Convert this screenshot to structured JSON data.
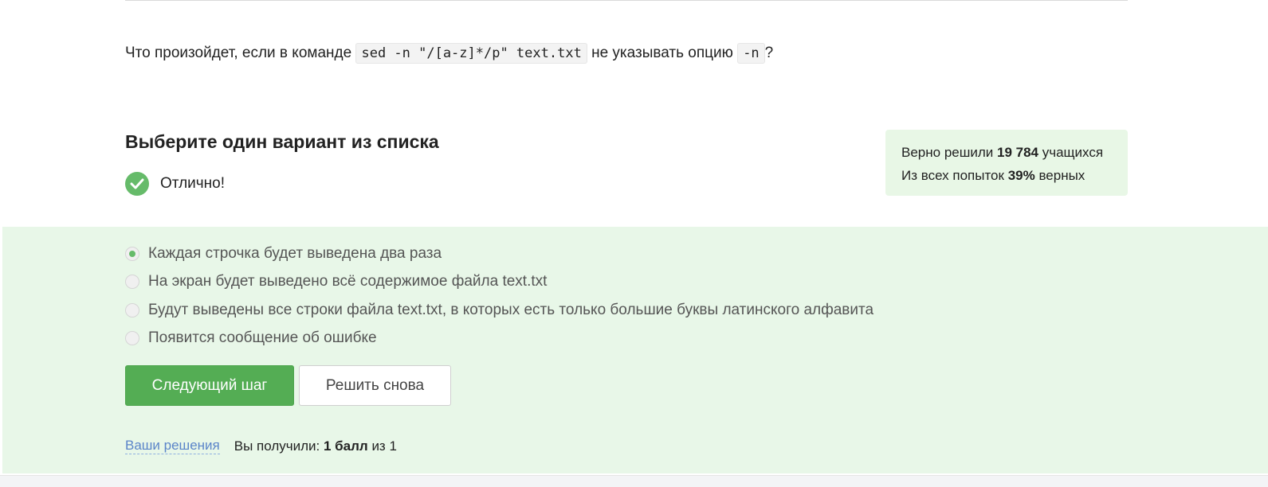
{
  "question": {
    "prefix": "Что произойдет, если в команде",
    "command": "sed -n \"/[a-z]*/p\" text.txt",
    "middle": "не указывать опцию",
    "option": "-n",
    "suffix": "?"
  },
  "quiz": {
    "heading": "Выберите один вариант из списка",
    "result_text": "Отлично!",
    "result_icon": "check-circle-icon"
  },
  "stats": {
    "line1_prefix": "Верно решили",
    "line1_count": "19 784",
    "line1_suffix": "учащихся",
    "line2_prefix": "Из всех попыток",
    "line2_percent": "39%",
    "line2_suffix": "верных"
  },
  "options": [
    {
      "label": "Каждая строчка будет выведена два раза",
      "selected": true
    },
    {
      "label": "На экран будет выведено всё содержимое файла text.txt",
      "selected": false
    },
    {
      "label": "Будут выведены все строки файла text.txt, в которых есть только большие буквы латинского алфавита",
      "selected": false
    },
    {
      "label": "Появится сообщение об ошибке",
      "selected": false
    }
  ],
  "buttons": {
    "next_label": "Следующий шаг",
    "retry_label": "Решить снова"
  },
  "footer": {
    "solutions_link": "Ваши решения",
    "score_prefix": "Вы получили:",
    "score_value": "1 балл",
    "score_suffix": "из 1"
  },
  "colors": {
    "accent_green": "#54ad54",
    "success_green": "#66bb6a",
    "panel_bg": "#e8f7e8",
    "link_blue": "#5b85c9"
  }
}
